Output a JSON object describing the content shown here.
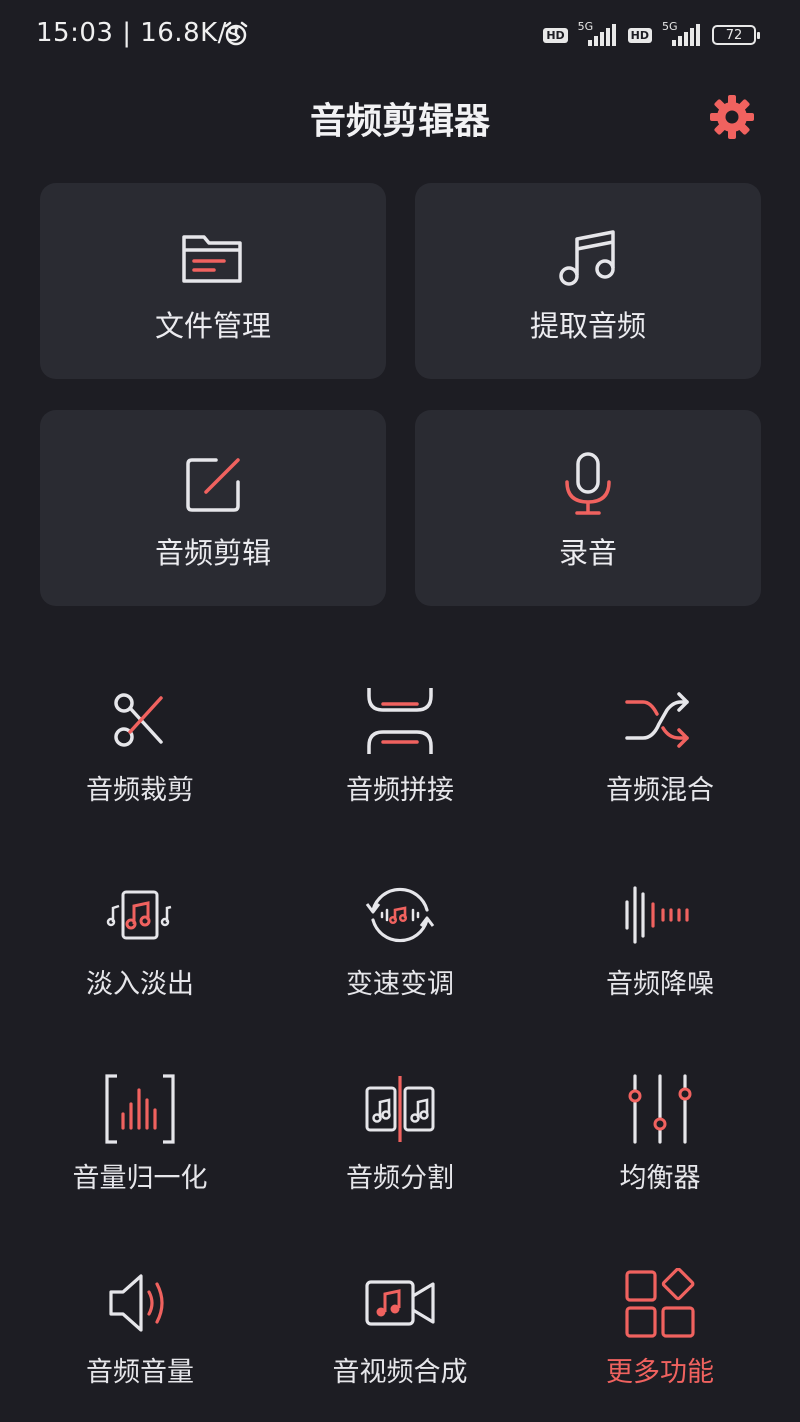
{
  "status_bar": {
    "time": "15:03 | 16.8K/s",
    "network_badge_1": "HD",
    "network_type_1": "5G",
    "network_badge_2": "HD",
    "network_type_2": "5G",
    "battery": "72"
  },
  "header": {
    "title": "音频剪辑器"
  },
  "cards": [
    {
      "label": "文件管理",
      "icon": "folder-icon"
    },
    {
      "label": "提取音频",
      "icon": "music-note-icon"
    },
    {
      "label": "音频剪辑",
      "icon": "edit-icon"
    },
    {
      "label": "录音",
      "icon": "microphone-icon"
    }
  ],
  "tools": [
    {
      "label": "音频裁剪",
      "icon": "scissors-icon"
    },
    {
      "label": "音频拼接",
      "icon": "splice-icon"
    },
    {
      "label": "音频混合",
      "icon": "shuffle-icon"
    },
    {
      "label": "淡入淡出",
      "icon": "fade-icon"
    },
    {
      "label": "变速变调",
      "icon": "speed-pitch-icon"
    },
    {
      "label": "音频降噪",
      "icon": "noise-reduction-icon"
    },
    {
      "label": "音量归一化",
      "icon": "normalize-icon"
    },
    {
      "label": "音频分割",
      "icon": "split-icon"
    },
    {
      "label": "均衡器",
      "icon": "equalizer-icon"
    },
    {
      "label": "音频音量",
      "icon": "volume-icon"
    },
    {
      "label": "音视频合成",
      "icon": "video-merge-icon"
    },
    {
      "label": "更多功能",
      "icon": "more-functions-icon"
    }
  ],
  "colors": {
    "background": "#1d1d23",
    "card": "#2a2b32",
    "accent": "#f0625f",
    "icon_line": "#e6e6ea"
  }
}
